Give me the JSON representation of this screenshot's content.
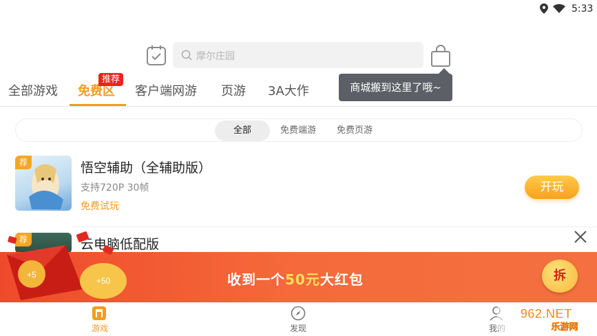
{
  "status_bar": {
    "time": "5:33",
    "icons": [
      "location-icon",
      "wifi-icon"
    ]
  },
  "header": {
    "search": {
      "placeholder": "摩尔庄园"
    },
    "icons": [
      "calendar-check-icon",
      "search-icon",
      "shopping-bag-icon"
    ]
  },
  "tabs": [
    {
      "label": "全部游戏",
      "active": false
    },
    {
      "label": "免费区",
      "active": true,
      "badge": "推荐"
    },
    {
      "label": "客户端网游",
      "active": false
    },
    {
      "label": "页游",
      "active": false
    },
    {
      "label": "3A大作",
      "active": false
    }
  ],
  "tooltip": "商城搬到这里了哦~",
  "filters": [
    {
      "label": "全部",
      "active": true
    },
    {
      "label": "免费端游",
      "active": false
    },
    {
      "label": "免费页游",
      "active": false
    }
  ],
  "games": [
    {
      "badge": "荐",
      "title": "悟空辅助（全辅助版）",
      "subtitle": "支持720P 30帧",
      "tag": "免费试玩",
      "action": "开玩"
    },
    {
      "badge": "荐",
      "title": "云电脑低配版"
    }
  ],
  "banner": {
    "text_pre": "收到一个",
    "amount": "50元",
    "text_post": "大红包",
    "open_label": "拆",
    "coin_labels": [
      "+5",
      "+50"
    ]
  },
  "bottom_nav": [
    {
      "label": "游戏",
      "icon": "game-icon",
      "active": true
    },
    {
      "label": "发现",
      "icon": "compass-icon",
      "active": false
    },
    {
      "label": "我的",
      "icon": "user-icon",
      "active": false
    }
  ],
  "watermark": {
    "text_top": "962.NET",
    "text_bottom": "乐游网"
  },
  "colors": {
    "accent": "#f39c1f",
    "badge_red": "#e8261a",
    "banner_red": "#ef4a2c",
    "tooltip_bg": "#5c6066"
  }
}
